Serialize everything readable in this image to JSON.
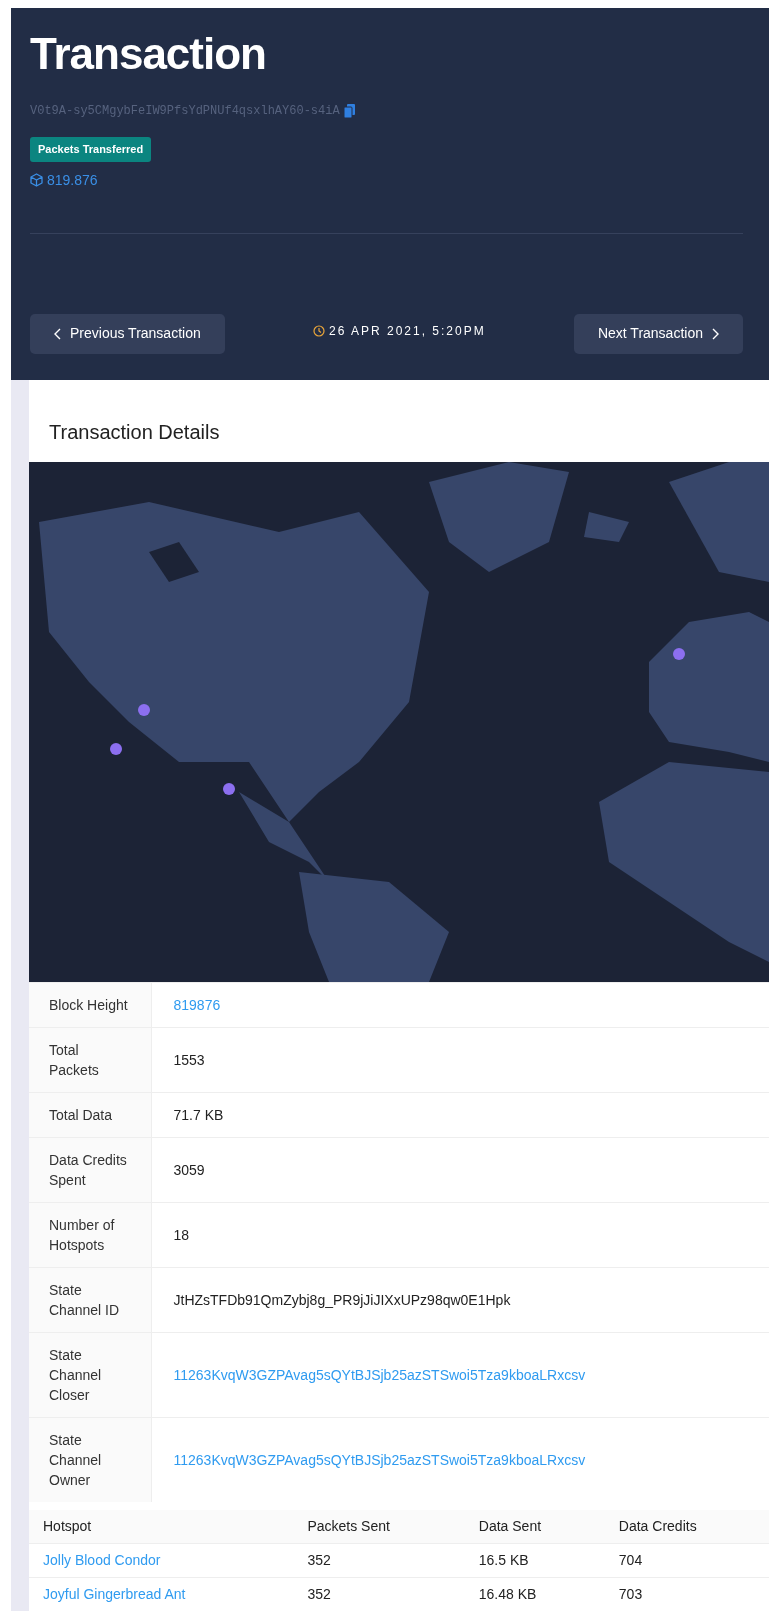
{
  "header": {
    "title": "Transaction",
    "hash": "V0t9A-sy5CMgybFeIW9PfsYdPNUf4qsxlhAY60-s4iA",
    "badge": "Packets Transferred",
    "block": "819.876",
    "previous_button": "Previous Transaction",
    "timestamp": "26 APR 2021, 5:20PM",
    "next_button": "Next Transaction"
  },
  "details": {
    "title": "Transaction Details",
    "rows": [
      {
        "label": "Block Height",
        "value": "819876",
        "kind": "link"
      },
      {
        "label": "Total Packets",
        "value": "1553",
        "kind": "text"
      },
      {
        "label": "Total Data",
        "value": "71.7 KB",
        "kind": "text"
      },
      {
        "label": "Data Credits Spent",
        "value": "3059",
        "kind": "text"
      },
      {
        "label": "Number of Hotspots",
        "value": "18",
        "kind": "text"
      },
      {
        "label": "State Channel ID",
        "value": "JtHZsTFDb91QmZybj8g_PR9jJiJIXxUPz98qw0E1Hpk",
        "kind": "text"
      },
      {
        "label": "State Channel Closer",
        "value": "11263KvqW3GZPAvag5sQYtBJSjb25azSTSwoi5Tza9kboaLRxcsv",
        "kind": "link"
      },
      {
        "label": "State Channel Owner",
        "value": "11263KvqW3GZPAvag5sQYtBJSjb25azSTSwoi5Tza9kboaLRxcsv",
        "kind": "link"
      }
    ]
  },
  "hotspots": {
    "columns": [
      "Hotspot",
      "Packets Sent",
      "Data Sent",
      "Data Credits"
    ],
    "rows": [
      [
        "Jolly Blood Condor",
        "352",
        "16.5 KB",
        "704"
      ],
      [
        "Joyful Gingerbread Ant",
        "352",
        "16.48 KB",
        "703"
      ]
    ]
  }
}
